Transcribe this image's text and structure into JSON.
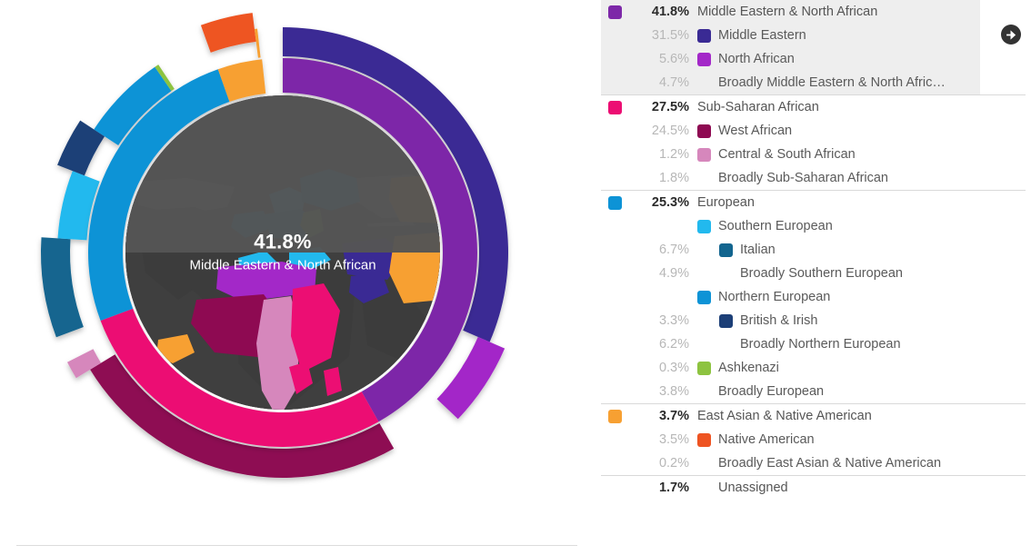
{
  "center": {
    "percent": "41.8%",
    "population": "Middle Eastern & North African"
  },
  "arrow_icon": "arrow-right-circle-icon",
  "colors": {
    "middle_eastern_north_african": "#7D28A8",
    "middle_eastern": "#3A2A94",
    "north_african": "#A328C8",
    "broadly_mena": "#7D28A8",
    "sub_saharan_african": "#EC0E73",
    "west_african": "#8E0A52",
    "central_south_african": "#D687BC",
    "broadly_ssa": "#EC0E73",
    "european": "#0D93D6",
    "southern_european": "#22B9EE",
    "italian": "#12658F",
    "broadly_southern_european": "#22B9EE",
    "northern_european": "#0D93D6",
    "british_irish": "#1C3F77",
    "broadly_northern_european": "#0D93D6",
    "ashkenazi": "#8DC340",
    "broadly_european": "#0D93D6",
    "east_asian_native_american": "#F7A032",
    "native_american": "#EE5422",
    "broadly_eana": "#F7A032",
    "unassigned": "#CCCCCC",
    "globe_land": "#444444",
    "globe_other": "#8E8E8E",
    "globe_disc": "#555555",
    "highlight_bg": "#EEEEEE",
    "divider": "#D9D9D9"
  },
  "legend": {
    "groups": [
      {
        "highlighted": true,
        "rows": [
          {
            "level": 0,
            "pct": "41.8%",
            "label": "Middle Eastern & North African",
            "swatch": "middle_eastern_north_african",
            "lead_swatch": true,
            "bold": true
          },
          {
            "level": 1,
            "pct": "31.5%",
            "label": "Middle Eastern",
            "swatch": "middle_eastern",
            "lead_swatch": false,
            "bold": false
          },
          {
            "level": 1,
            "pct": "5.6%",
            "label": "North African",
            "swatch": "north_african",
            "lead_swatch": false,
            "bold": false
          },
          {
            "level": 1,
            "pct": "4.7%",
            "label": "Broadly Middle Eastern & North Afric…",
            "swatch": null,
            "lead_swatch": false,
            "bold": false
          }
        ]
      },
      {
        "highlighted": false,
        "rows": [
          {
            "level": 0,
            "pct": "27.5%",
            "label": "Sub-Saharan African",
            "swatch": "sub_saharan_african",
            "lead_swatch": true,
            "bold": true
          },
          {
            "level": 1,
            "pct": "24.5%",
            "label": "West African",
            "swatch": "west_african",
            "lead_swatch": false,
            "bold": false
          },
          {
            "level": 1,
            "pct": "1.2%",
            "label": "Central & South African",
            "swatch": "central_south_african",
            "lead_swatch": false,
            "bold": false
          },
          {
            "level": 1,
            "pct": "1.8%",
            "label": "Broadly Sub-Saharan African",
            "swatch": null,
            "lead_swatch": false,
            "bold": false
          }
        ]
      },
      {
        "highlighted": false,
        "rows": [
          {
            "level": 0,
            "pct": "25.3%",
            "label": "European",
            "swatch": "european",
            "lead_swatch": true,
            "bold": true
          },
          {
            "level": 1,
            "pct": "",
            "label": "Southern European",
            "swatch": "southern_european",
            "lead_swatch": false,
            "bold": false
          },
          {
            "level": 2,
            "pct": "6.7%",
            "label": "Italian",
            "swatch": "italian",
            "lead_swatch": false,
            "bold": false
          },
          {
            "level": 2,
            "pct": "4.9%",
            "label": "Broadly Southern European",
            "swatch": null,
            "lead_swatch": false,
            "bold": false
          },
          {
            "level": 1,
            "pct": "",
            "label": "Northern European",
            "swatch": "northern_european",
            "lead_swatch": false,
            "bold": false
          },
          {
            "level": 2,
            "pct": "3.3%",
            "label": "British & Irish",
            "swatch": "british_irish",
            "lead_swatch": false,
            "bold": false
          },
          {
            "level": 2,
            "pct": "6.2%",
            "label": "Broadly Northern European",
            "swatch": null,
            "lead_swatch": false,
            "bold": false
          },
          {
            "level": 1,
            "pct": "0.3%",
            "label": "Ashkenazi",
            "swatch": "ashkenazi",
            "lead_swatch": false,
            "bold": false
          },
          {
            "level": 1,
            "pct": "3.8%",
            "label": "Broadly European",
            "swatch": null,
            "lead_swatch": false,
            "bold": false
          }
        ]
      },
      {
        "highlighted": false,
        "rows": [
          {
            "level": 0,
            "pct": "3.7%",
            "label": "East Asian & Native American",
            "swatch": "east_asian_native_american",
            "lead_swatch": true,
            "bold": true
          },
          {
            "level": 1,
            "pct": "3.5%",
            "label": "Native American",
            "swatch": "native_american",
            "lead_swatch": false,
            "bold": false
          },
          {
            "level": 1,
            "pct": "0.2%",
            "label": "Broadly East Asian & Native American",
            "swatch": null,
            "lead_swatch": false,
            "bold": false
          }
        ]
      },
      {
        "highlighted": false,
        "rows": [
          {
            "level": 0,
            "pct": "1.7%",
            "label": "Unassigned",
            "swatch": null,
            "lead_swatch": false,
            "bold": true
          }
        ]
      }
    ]
  },
  "chart_data": {
    "type": "pie",
    "title": "Ancestry Composition",
    "center_value": 41.8,
    "center_label": "Middle Eastern & North African",
    "rings": [
      {
        "name": "inner-ring-populations",
        "slices": [
          {
            "label": "Middle Eastern & North African",
            "value": 41.8,
            "color": "#7D28A8"
          },
          {
            "label": "Sub-Saharan African",
            "value": 27.5,
            "color": "#EC0E73"
          },
          {
            "label": "European",
            "value": 25.3,
            "color": "#0D93D6"
          },
          {
            "label": "East Asian & Native American",
            "value": 3.7,
            "color": "#F7A032"
          },
          {
            "label": "Unassigned",
            "value": 1.7,
            "color": "#FFFFFF"
          }
        ]
      },
      {
        "name": "outer-ring-subpopulations",
        "slices": [
          {
            "label": "Middle Eastern",
            "value": 31.5,
            "color": "#3A2A94"
          },
          {
            "label": "North African",
            "value": 5.6,
            "color": "#A328C8"
          },
          {
            "label": "Broadly Middle Eastern & North African",
            "value": 4.7,
            "color": "#FFFFFF"
          },
          {
            "label": "West African",
            "value": 24.5,
            "color": "#8E0A52"
          },
          {
            "label": "Central & South African",
            "value": 1.2,
            "color": "#D687BC"
          },
          {
            "label": "Broadly Sub-Saharan African",
            "value": 1.8,
            "color": "#FFFFFF"
          },
          {
            "label": "Italian",
            "value": 6.7,
            "color": "#12658F"
          },
          {
            "label": "Broadly Southern European",
            "value": 4.9,
            "color": "#22B9EE"
          },
          {
            "label": "British & Irish",
            "value": 3.3,
            "color": "#1C3F77"
          },
          {
            "label": "Broadly Northern European",
            "value": 6.2,
            "color": "#0D93D6"
          },
          {
            "label": "Ashkenazi",
            "value": 0.3,
            "color": "#8DC340"
          },
          {
            "label": "Broadly European",
            "value": 3.8,
            "color": "#FFFFFF"
          },
          {
            "label": "Native American",
            "value": 3.5,
            "color": "#EE5422"
          },
          {
            "label": "Broadly East Asian & Native American",
            "value": 0.2,
            "color": "#F7A032"
          }
        ]
      }
    ],
    "total": 100
  }
}
